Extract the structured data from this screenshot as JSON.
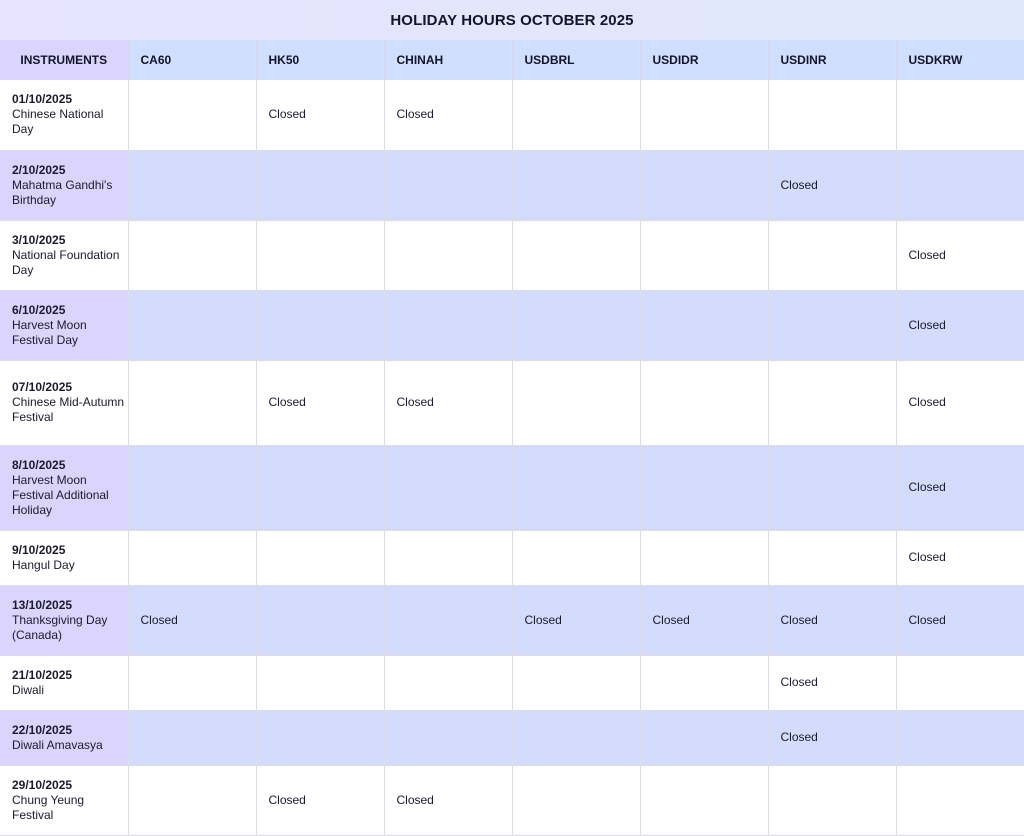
{
  "title": "HOLIDAY HOURS OCTOBER 2025",
  "columns": [
    "INSTRUMENTS",
    "CA60",
    "HK50",
    "CHINAH",
    "USDBRL",
    "USDIDR",
    "USDINR",
    "USDKRW"
  ],
  "rows": [
    {
      "date": "01/10/2025",
      "name": "Chinese National Day",
      "cells": [
        "",
        "Closed",
        "Closed",
        "",
        "",
        "",
        ""
      ]
    },
    {
      "date": "2/10/2025",
      "name": "Mahatma Gandhi's Birthday",
      "cells": [
        "",
        "",
        "",
        "",
        "",
        "Closed",
        ""
      ]
    },
    {
      "date": "3/10/2025",
      "name": "National Foundation Day",
      "cells": [
        "",
        "",
        "",
        "",
        "",
        "",
        "Closed"
      ]
    },
    {
      "date": "6/10/2025",
      "name": "Harvest Moon Festival Day",
      "cells": [
        "",
        "",
        "",
        "",
        "",
        "",
        "Closed"
      ]
    },
    {
      "date": "07/10/2025",
      "name": "Chinese Mid-Autumn Festival",
      "cells": [
        "",
        "Closed",
        "Closed",
        "",
        "",
        "",
        "Closed"
      ]
    },
    {
      "date": "8/10/2025",
      "name": "Harvest Moon Festival Additional Holiday",
      "cells": [
        "",
        "",
        "",
        "",
        "",
        "",
        "Closed"
      ]
    },
    {
      "date": "9/10/2025",
      "name": "Hangul Day",
      "cells": [
        "",
        "",
        "",
        "",
        "",
        "",
        "Closed"
      ]
    },
    {
      "date": "13/10/2025",
      "name": "Thanksgiving Day (Canada)",
      "cells": [
        "Closed",
        "",
        "",
        "Closed",
        "Closed",
        "Closed",
        "Closed"
      ]
    },
    {
      "date": "21/10/2025",
      "name": "Diwali",
      "cells": [
        "",
        "",
        "",
        "",
        "",
        "Closed",
        ""
      ]
    },
    {
      "date": "22/10/2025",
      "name": "Diwali Amavasya",
      "cells": [
        "",
        "",
        "",
        "",
        "",
        "Closed",
        ""
      ]
    },
    {
      "date": "29/10/2025",
      "name": "Chung Yeung Festival",
      "cells": [
        "",
        "Closed",
        "Closed",
        "",
        "",
        "",
        ""
      ]
    }
  ]
}
